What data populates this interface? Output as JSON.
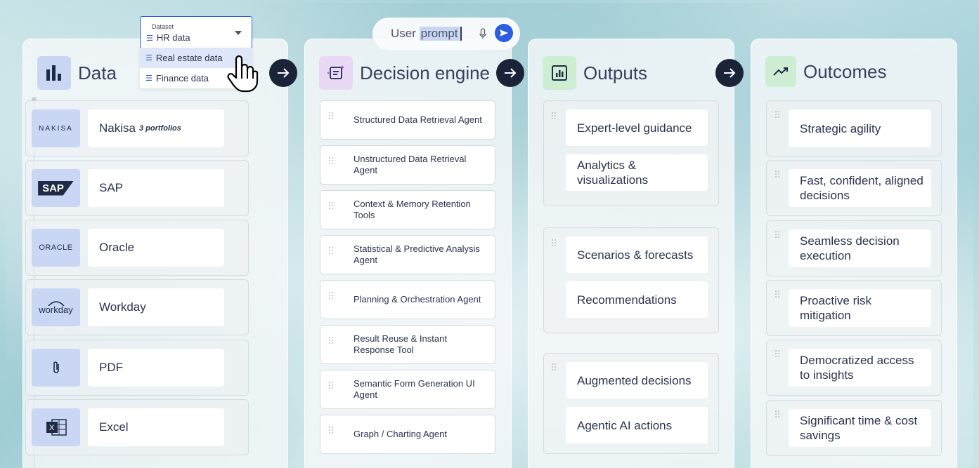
{
  "prompt": {
    "text_before": "User ",
    "selected": "prompt"
  },
  "dataset": {
    "label": "Dataset",
    "value": "HR data",
    "options": [
      "Real estate data",
      "Finance data"
    ]
  },
  "data_panel": {
    "title": "Data",
    "sources": [
      {
        "logo": "NAKISA",
        "label": "Nakisa",
        "note": "3 portfolios"
      },
      {
        "logo": "SAP",
        "label": "SAP"
      },
      {
        "logo": "ORACLE",
        "label": "Oracle"
      },
      {
        "logo": "workday",
        "label": "Workday"
      },
      {
        "logo": "paperclip-icon",
        "label": "PDF"
      },
      {
        "logo": "excel-icon",
        "label": "Excel"
      }
    ]
  },
  "engine_panel": {
    "title": "Decision engine",
    "agents": [
      "Structured Data Retrieval Agent",
      "Unstructured Data Retrieval Agent",
      "Context & Memory Retention Tools",
      "Statistical & Predictive Analysis Agent",
      "Planning & Orchestration Agent",
      "Result Reuse & Instant Response Tool",
      "Semantic Form Generation UI Agent",
      "Graph / Charting Agent"
    ]
  },
  "outputs_panel": {
    "title": "Outputs",
    "groups": [
      [
        "Expert-level guidance",
        "Analytics & visualizations"
      ],
      [
        "Scenarios & forecasts",
        "Recommendations"
      ],
      [
        "Augmented decisions",
        "Agentic AI actions"
      ]
    ]
  },
  "outcomes_panel": {
    "title": "Outcomes",
    "items": [
      "Strategic agility",
      "Fast, confident, aligned decisions",
      "Seamless decision execution",
      "Proactive risk mitigation",
      "Democratized access to insights",
      "Significant time & cost savings"
    ]
  },
  "colors": {
    "accent": "#2a5de0",
    "arrow": "#1a2338",
    "logo_bg": "#c9d7f5",
    "engine_icon_bg": "#ead9f5",
    "outputs_icon_bg": "#cdeed2"
  }
}
